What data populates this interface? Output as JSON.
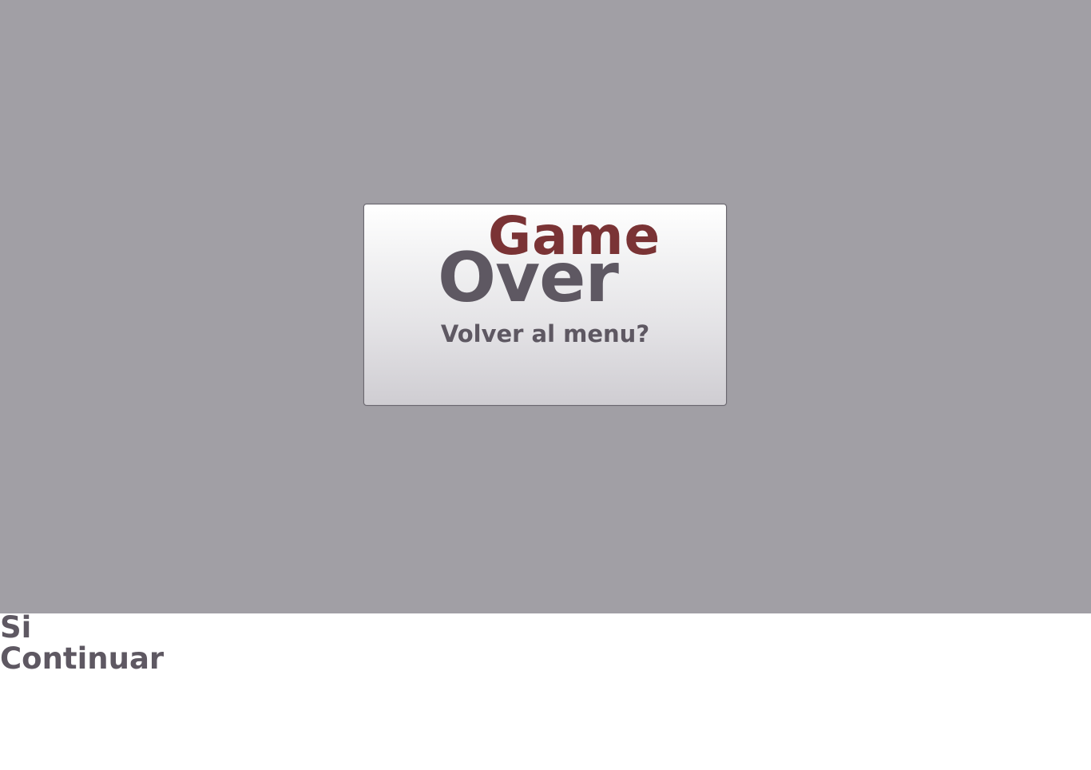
{
  "dialog": {
    "title_word1": "Game",
    "title_word2": "Over",
    "question": "Volver al menu?"
  },
  "options": {
    "yes_label": "Si",
    "continue_label": "Continuar"
  },
  "colors": {
    "stage_background": "#a19fa5",
    "title_game": "#7a3335",
    "text_primary": "#5e5862",
    "page_background": "#ffffff"
  }
}
